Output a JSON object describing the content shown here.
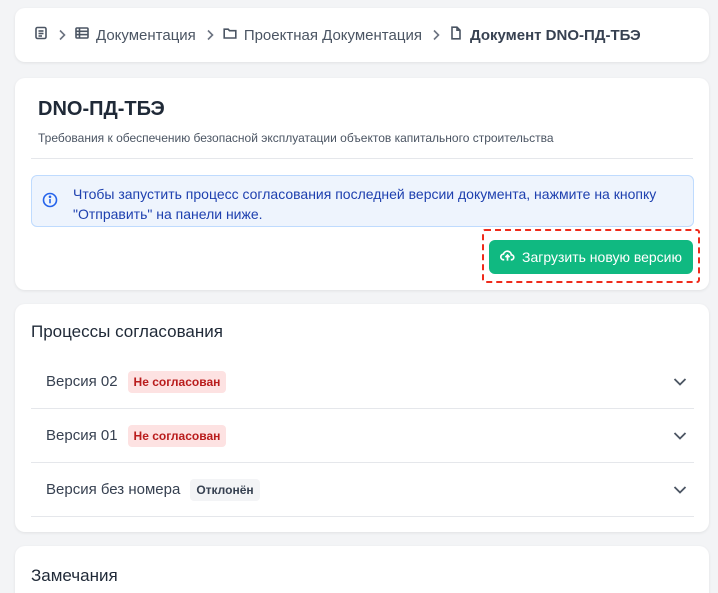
{
  "breadcrumb": {
    "items": [
      {
        "label": "",
        "icon": "document-list-icon"
      },
      {
        "label": "Документация",
        "icon": "table-icon"
      },
      {
        "label": "Проектная Документация",
        "icon": "folder-icon"
      },
      {
        "label": "Документ DNO-ПД-ТБЭ",
        "icon": "file-icon"
      }
    ]
  },
  "document": {
    "title": "DNO-ПД-ТБЭ",
    "subtitle": "Требования к обеспечению безопасной эксплуатации объектов капитального строительства",
    "info_line1": "Чтобы запустить процесс согласования последней версии документа, нажмите на кнопку",
    "info_line2": "\"Отправить\" на панели ниже.",
    "upload_label": "Загрузить новую версию"
  },
  "processes": {
    "title": "Процессы согласования",
    "rows": [
      {
        "label": "Версия 02",
        "status": "Не согласован"
      },
      {
        "label": "Версия 01",
        "status": "Не согласован"
      },
      {
        "label": "Версия без номера",
        "status": "Отклонён"
      }
    ]
  },
  "remarks": {
    "title": "Замечания"
  },
  "colors": {
    "accent_green": "#10b981",
    "info_blue": "#1e40af",
    "highlight_red": "#ef2b1b"
  }
}
